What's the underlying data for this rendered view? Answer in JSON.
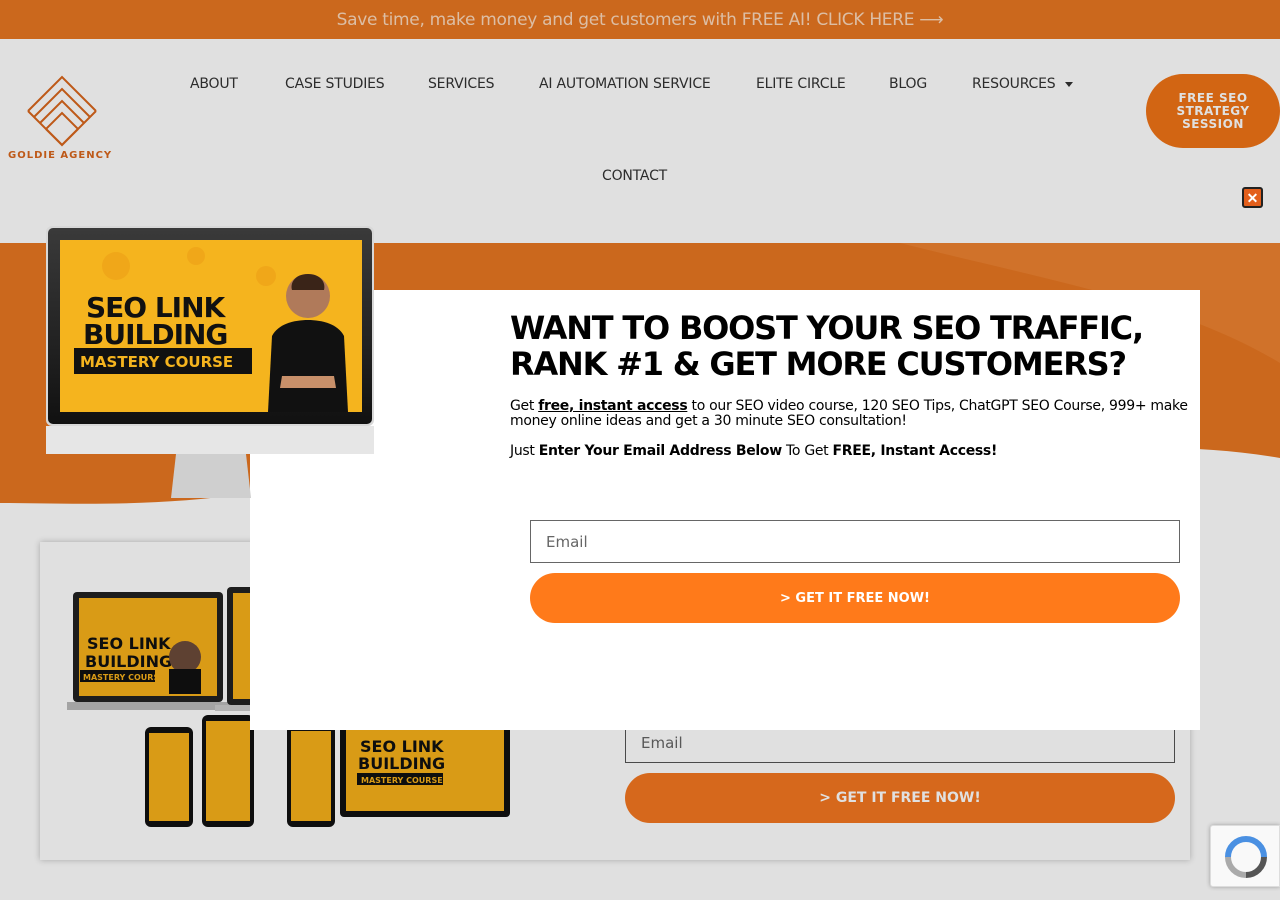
{
  "banner": {
    "text": "Save time, make money and get customers with FREE AI! CLICK HERE ⟶"
  },
  "brand": {
    "name": "GOLDIE AGENCY",
    "accent": "#e87722"
  },
  "nav": {
    "items": [
      {
        "label": "ABOUT"
      },
      {
        "label": "CASE STUDIES"
      },
      {
        "label": "SERVICES"
      },
      {
        "label": "AI AUTOMATION SERVICE"
      },
      {
        "label": "ELITE CIRCLE"
      },
      {
        "label": "BLOG"
      },
      {
        "label": "RESOURCES"
      },
      {
        "label": "CONTACT"
      }
    ],
    "cta_label": "FREE SEO\nSTRATEGY\nSESSION"
  },
  "monitor": {
    "line1": "SEO LINK",
    "line2": "BUILDING",
    "ribbon": "MASTERY COURSE"
  },
  "popup": {
    "title": "WANT TO BOOST YOUR SEO TRAFFIC, RANK #1 & GET MORE CUSTOMERS?",
    "desc_prefix": "Get ",
    "desc_link": "free, instant access",
    "desc_suffix": " to our SEO video course, 120 SEO Tips, ChatGPT SEO Course, 999+ make money online ideas and get a 30 minute SEO consultation!",
    "desc2_prefix": "Just ",
    "desc2_bold1": "Enter Your Email Address Below",
    "desc2_mid": " To Get ",
    "desc2_bold2": "FREE, Instant Access!",
    "email_placeholder": "Email",
    "button_label": "> GET IT FREE NOW!",
    "close_icon": "close-icon"
  },
  "card": {
    "email_placeholder": "Email",
    "button_label": "> GET IT FREE NOW!",
    "device_line1": "SEO LINK",
    "device_line2": "BUILDING",
    "device_ribbon": "MASTERY COURSE"
  }
}
